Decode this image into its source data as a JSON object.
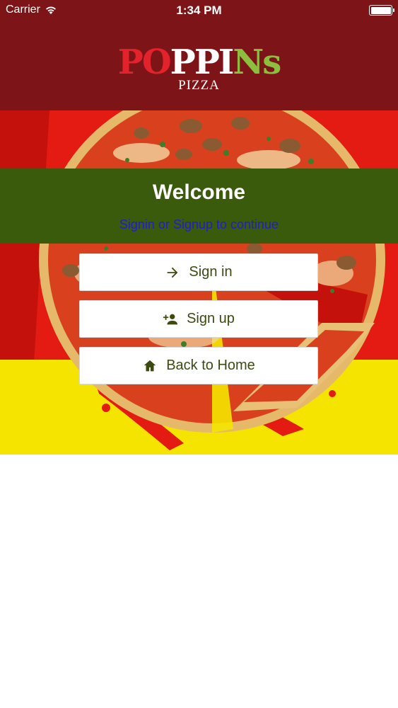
{
  "status_bar": {
    "carrier": "Carrier",
    "time": "1:34 PM"
  },
  "brand": {
    "letters": [
      {
        "char": "P",
        "color": "#e4222b"
      },
      {
        "char": "O",
        "color": "#e4222b"
      },
      {
        "char": "P",
        "color": "#ffffff"
      },
      {
        "char": "P",
        "color": "#ffffff"
      },
      {
        "char": "I",
        "color": "#ffffff"
      },
      {
        "char": "N",
        "color": "#8cbf3f"
      },
      {
        "char": "s",
        "color": "#8cbf3f"
      }
    ],
    "subtitle": "PIZZA"
  },
  "welcome": {
    "title": "Welcome",
    "subtitle": "Signin or Signup to continue"
  },
  "buttons": {
    "signin": {
      "label": "Sign in",
      "icon": "arrow-right-icon"
    },
    "signup": {
      "label": "Sign up",
      "icon": "person-add-icon"
    },
    "home": {
      "label": "Back to Home",
      "icon": "home-icon"
    }
  },
  "colors": {
    "header_bg": "#7d1518",
    "welcome_bg": "#3a5a0c",
    "link_blue": "#1e1ecf",
    "button_text": "#3c4a10",
    "hero_red": "#e31b12",
    "hero_yellow": "#f5e400"
  }
}
